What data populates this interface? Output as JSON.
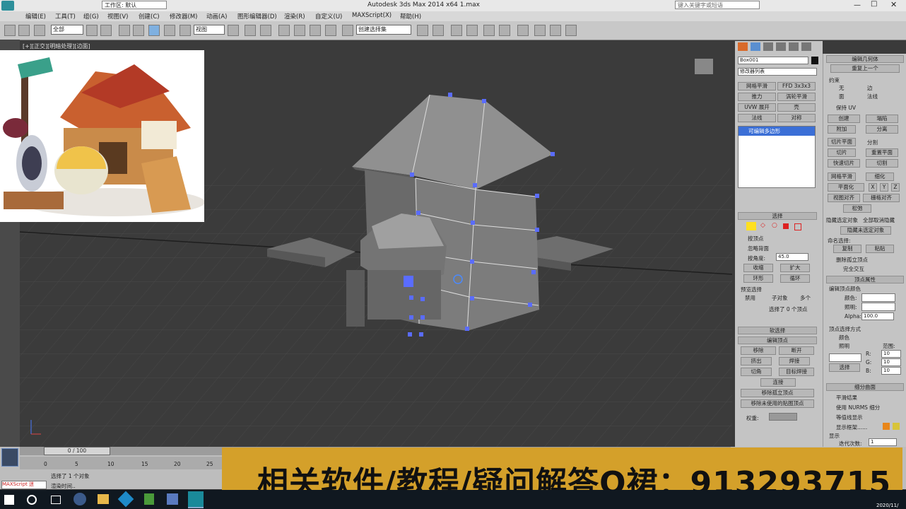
{
  "window": {
    "title": "Autodesk 3ds Max  2014 x64    1.max",
    "workspace": "工作区: 默认",
    "search_placeholder": "键入关键字或短语"
  },
  "menu": [
    "编辑(E)",
    "工具(T)",
    "组(G)",
    "视图(V)",
    "创建(C)",
    "修改器(M)",
    "动画(A)",
    "图形编辑器(D)",
    "渲染(R)",
    "自定义(U)",
    "MAXScript(X)",
    "帮助(H)"
  ],
  "toolbar": {
    "filter": "全部",
    "coord": "视图",
    "selset": "创建选择集"
  },
  "viewport": {
    "label": "[+][正交][明暗处理][边面]"
  },
  "command_panel": {
    "object_name": "Box001",
    "modifier_list": "修改器列表",
    "mod_buttons": [
      "网格平滑",
      "FFD 3x3x3",
      "推力",
      "涡轮平滑",
      "UVW 展开",
      "壳",
      "法线",
      "对称"
    ],
    "stack_item": "可编辑多边形",
    "selection": {
      "header": "选择",
      "by_vertex": "按顶点",
      "ignore_backfacing": "忽略背面",
      "by_angle": "按角度:",
      "angle_value": "45.0",
      "shrink": "收缩",
      "grow": "扩大",
      "ring": "环形",
      "loop": "循环",
      "preview_label": "预览选择",
      "preview_opts": [
        "禁用",
        "子对象",
        "多个"
      ],
      "status": "选择了 0 个顶点"
    },
    "soft_sel": "软选择",
    "edit_vertices": {
      "header": "编辑顶点",
      "remove": "移除",
      "break": "断开",
      "extrude": "挤出",
      "weld": "焊接",
      "chamfer": "切角",
      "target_weld": "目标焊接",
      "connect": "连接",
      "remove_isolated": "移除孤立顶点",
      "remove_unused": "移除未使用的贴图顶点",
      "weight": "权重:"
    }
  },
  "command_panel2": {
    "edit_geom": "编辑几何体",
    "repeat_last": "重复上一个",
    "constraints": "约束",
    "cons_opts": [
      "无",
      "边",
      "面",
      "法线"
    ],
    "preserve_uv": "保持 UV",
    "create": "创建",
    "collapse": "塌陷",
    "attach": "附加",
    "detach": "分离",
    "slice_plane": "切片平面",
    "split": "分割",
    "slice": "切片",
    "reset_plane": "重置平面",
    "quickslice": "快速切片",
    "cut": "切割",
    "meshsmooth": "网格平滑",
    "tessellate": "细化",
    "planarize": "平面化",
    "x": "X",
    "y": "Y",
    "z": "Z",
    "view_align": "视图对齐",
    "grid_align": "栅格对齐",
    "relax": "松弛",
    "hide_sel": "隐藏选定对象",
    "unhide_all": "全部取消隐藏",
    "hide_unsel": "隐藏未选定对象",
    "named_sel": "命名选择:",
    "copy": "复制",
    "paste": "粘贴",
    "delete_iso": "删除孤立顶点",
    "full_interactivity": "完全交互",
    "vertex_props": "顶点属性",
    "edit_vertex_color": "编辑顶点颜色",
    "color": "颜色:",
    "illum": "照明:",
    "alpha": "Alpha:",
    "alpha_val": "100.0",
    "select_by": "顶点选择方式",
    "sel_color": "颜色",
    "sel_illum": "照明",
    "range": "范围:",
    "r": "R:",
    "g": "G:",
    "b": "B:",
    "rv": "10",
    "gv": "10",
    "bv": "10",
    "select": "选择",
    "subdiv_surface": "细分曲面",
    "smooth_result": "平滑结果",
    "use_nurms": "使用 NURMS 细分",
    "isoline": "等值线显示",
    "show_cage": "显示框架......",
    "display": "显示",
    "iterations": "迭代次数:",
    "iter_val": "1"
  },
  "timeline": {
    "frame": "0 / 100",
    "ticks": [
      "0",
      "5",
      "10",
      "15",
      "20",
      "25"
    ],
    "status1": "选择了 1 个对象",
    "status2": "渲染时间..",
    "maxscript": "MAXScript 迷"
  },
  "banner": {
    "text": "相关软件/教程/疑问解答Q裙：913293715"
  },
  "taskbar": {
    "date": "2020/11/"
  }
}
